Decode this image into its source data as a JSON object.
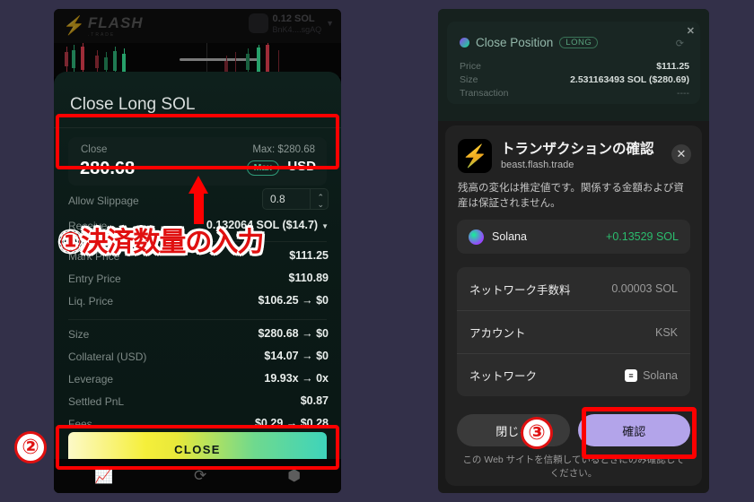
{
  "background_color": "#333049",
  "left_phone": {
    "topbar": {
      "brand": "FLASH",
      "brand_sub": ".TRADE",
      "bolt_icon": "bolt-icon",
      "wallet_amount": "0.12 SOL",
      "wallet_address": "BnK4....sgAQ",
      "chevron_icon": "chevron-down-icon"
    },
    "sheet": {
      "title": "Close Long SOL",
      "close_field": {
        "label": "Close",
        "max_label": "Max: $280.68",
        "value": "280.68",
        "max_badge": "Max",
        "currency": "USD",
        "badge_color": "#46c99c"
      },
      "rows": [
        {
          "key": "Allow Slippage",
          "value": "0.8",
          "type": "stepper"
        },
        {
          "key": "Receive",
          "value": "0.132064 SOL ($14.7)",
          "type": "dropdown"
        },
        {
          "key": "Mark Price",
          "value": "$111.25",
          "type": "text"
        },
        {
          "key": "Entry Price",
          "value": "$110.89",
          "type": "text"
        },
        {
          "key": "Liq. Price",
          "value": "$106.25 → $0",
          "type": "text"
        },
        {
          "key": "Size",
          "value": "$280.68 → $0",
          "type": "text"
        },
        {
          "key": "Collateral (USD)",
          "value": "$14.07 → $0",
          "type": "text"
        },
        {
          "key": "Leverage",
          "value": "19.93x → 0x",
          "type": "text"
        },
        {
          "key": "Settled PnL",
          "value": "$0.87",
          "type": "text"
        },
        {
          "key": "Fees",
          "value": "$0.29 → $0.28",
          "type": "text"
        }
      ],
      "close_button": "CLOSE"
    },
    "bottom_nav": [
      {
        "icon": "chart-icon",
        "active": true
      },
      {
        "icon": "swap-icon",
        "active": false
      },
      {
        "icon": "dice-icon",
        "active": false
      }
    ]
  },
  "right_phone": {
    "position_card": {
      "title": "Close Position",
      "side_badge": "LONG",
      "close_icon": "close-icon",
      "spinner_icon": "spinner-icon",
      "rows": [
        {
          "key": "Price",
          "value": "$111.25"
        },
        {
          "key": "Size",
          "value": "2.531163493 SOL ($280.69)"
        },
        {
          "key": "Transaction",
          "value": "----"
        }
      ]
    },
    "modal": {
      "app_icon": "flash-bolt-icon",
      "title": "トランザクションの確認",
      "domain": "beast.flash.trade",
      "close_icon": "close-icon",
      "description": "残高の変化は推定値です。関係する金額および資産は保証されません。",
      "asset_row": {
        "icon": "solana-icon",
        "name": "Solana",
        "amount": "+0.13529 SOL",
        "amount_color": "#2bbd6e"
      },
      "details": [
        {
          "key": "ネットワーク手数料",
          "value": "0.00003 SOL",
          "icon": ""
        },
        {
          "key": "アカウント",
          "value": "KSK",
          "icon": ""
        },
        {
          "key": "ネットワーク",
          "value": "Solana",
          "icon": "solana-square-icon"
        }
      ],
      "cancel_button": "閉じる",
      "confirm_button": "確認",
      "confirm_color": "#b3a4ea",
      "footer": "この Web サイトを信頼しているときにのみ確認してください。"
    }
  },
  "annotations": {
    "badge_2": "②",
    "badge_3": "③",
    "caption_1": "①決済数量の入力",
    "highlight_color": "#fe0000"
  }
}
